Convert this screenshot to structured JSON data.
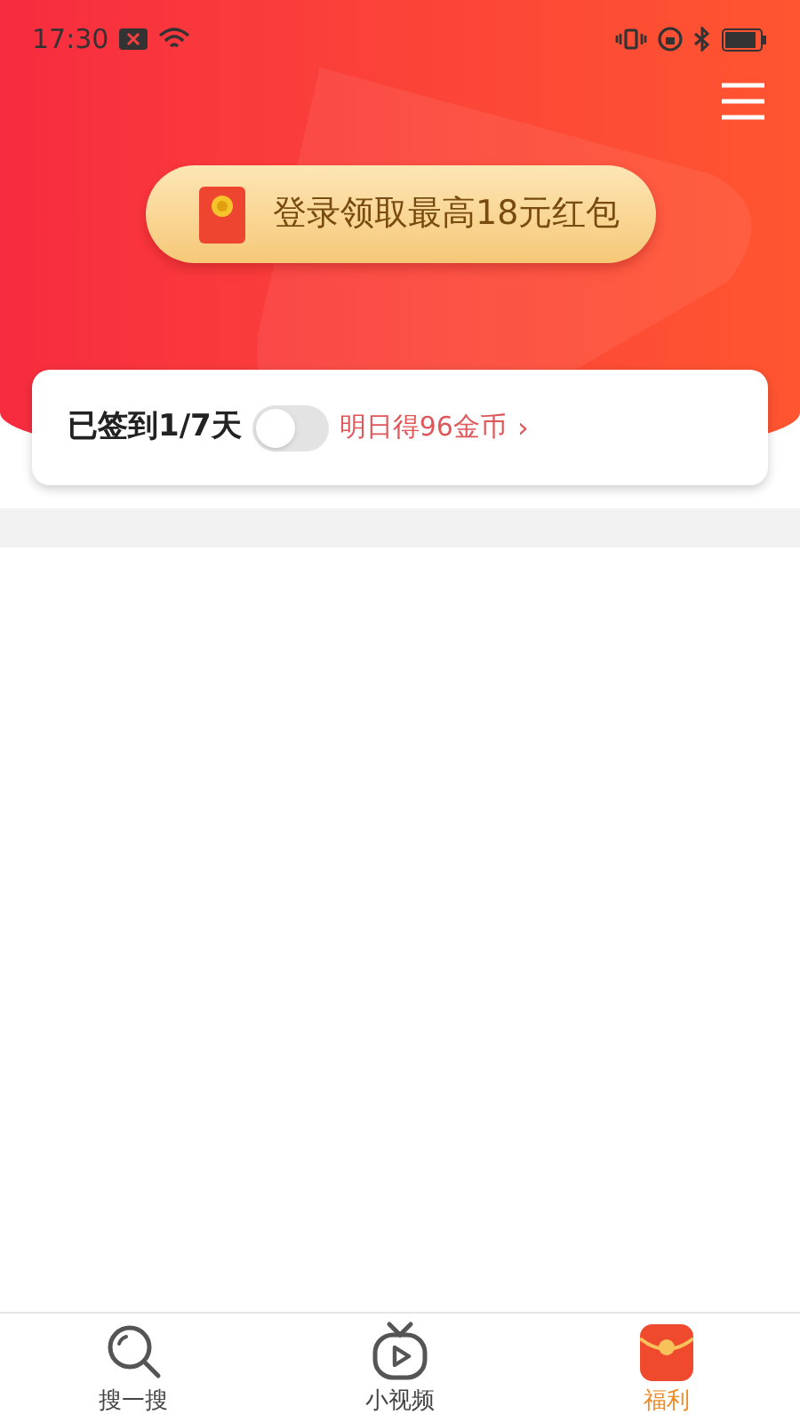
{
  "status_bar": {
    "time": "17:30"
  },
  "banner": {
    "label": "登录领取最高18元红包"
  },
  "checkin": {
    "label": "已签到1/7天",
    "reminder_on": false,
    "reward": "明日得96金币",
    "chevron": "›"
  },
  "tabs": [
    {
      "kind": "search",
      "label": "搜一搜",
      "selected": false
    },
    {
      "kind": "video",
      "label": "小视频",
      "selected": false
    },
    {
      "kind": "redpacket",
      "label": "福利",
      "selected": true
    }
  ]
}
